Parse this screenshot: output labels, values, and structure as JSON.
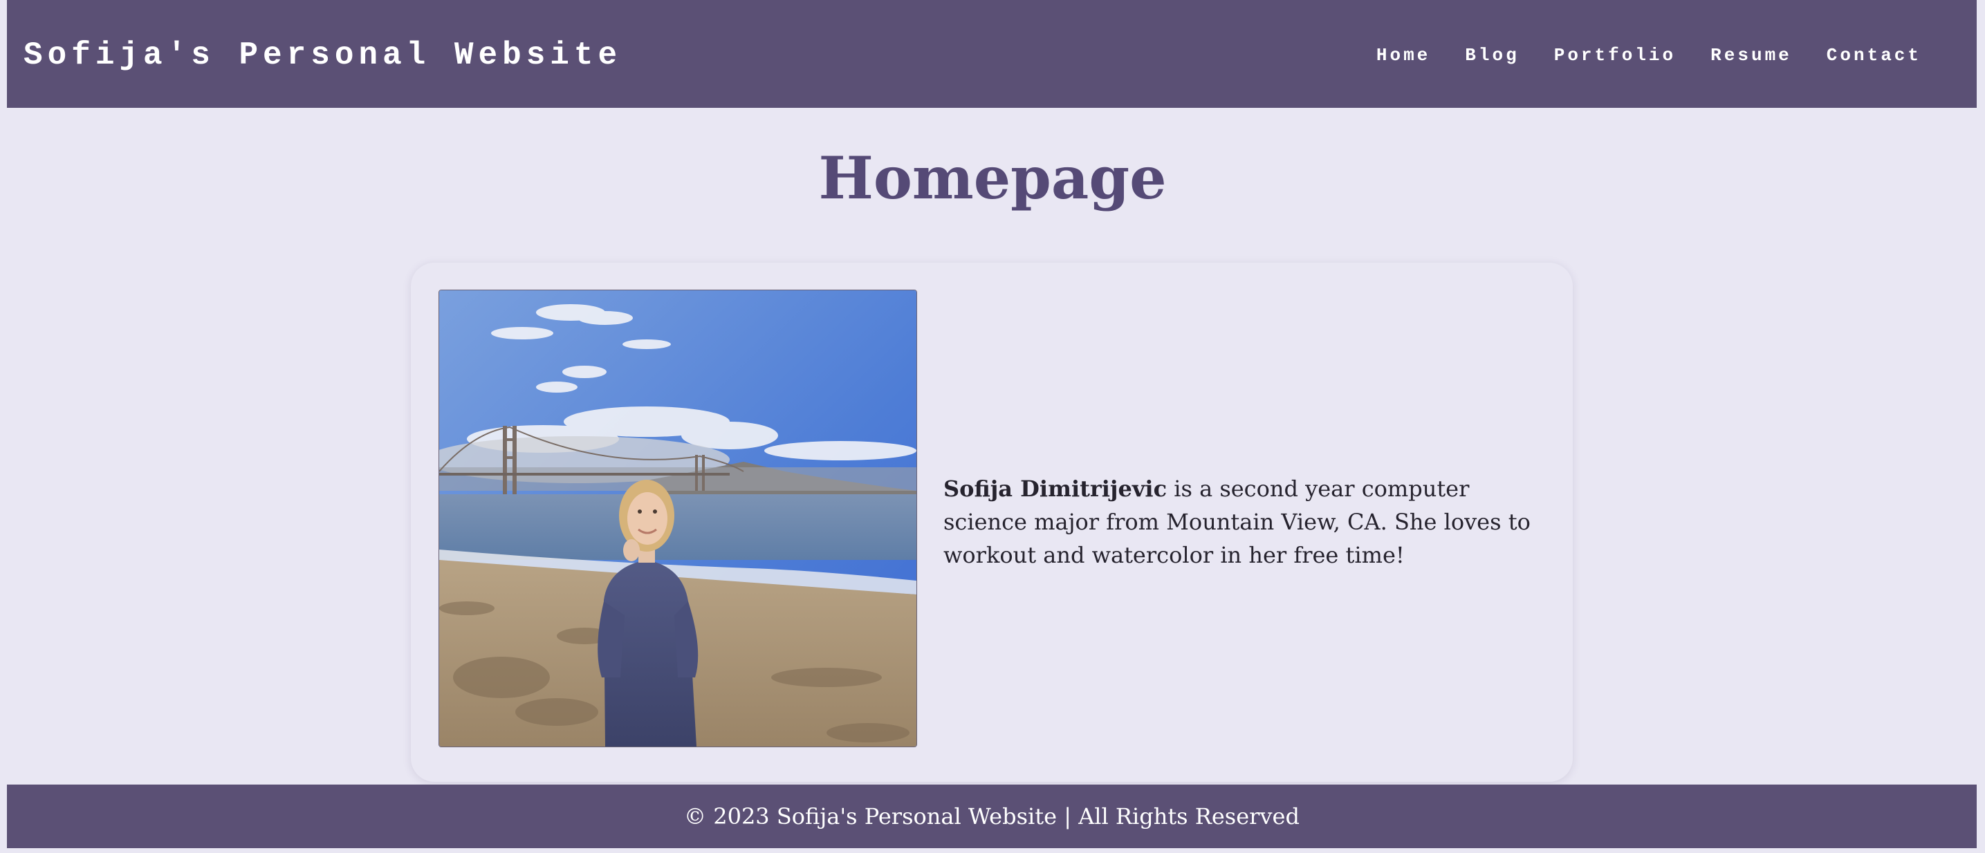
{
  "header": {
    "site_title": "Sofija's Personal Website",
    "nav": {
      "home": "Home",
      "blog": "Blog",
      "portfolio": "Portfolio",
      "resume": "Resume",
      "contact": "Contact"
    }
  },
  "main": {
    "page_title": "Homepage",
    "bio": {
      "name": "Sofija Dimitrijevic",
      "text": " is a second year computer science major from Mountain View, CA. She loves to workout and watercolor in her free time!"
    }
  },
  "footer": {
    "text": "© 2023 Sofija's Personal Website | All Rights Reserved"
  },
  "colors": {
    "header_bg": "#5b5075",
    "page_bg": "#e9e7f3",
    "title": "#554a76",
    "text": "#26232e"
  }
}
